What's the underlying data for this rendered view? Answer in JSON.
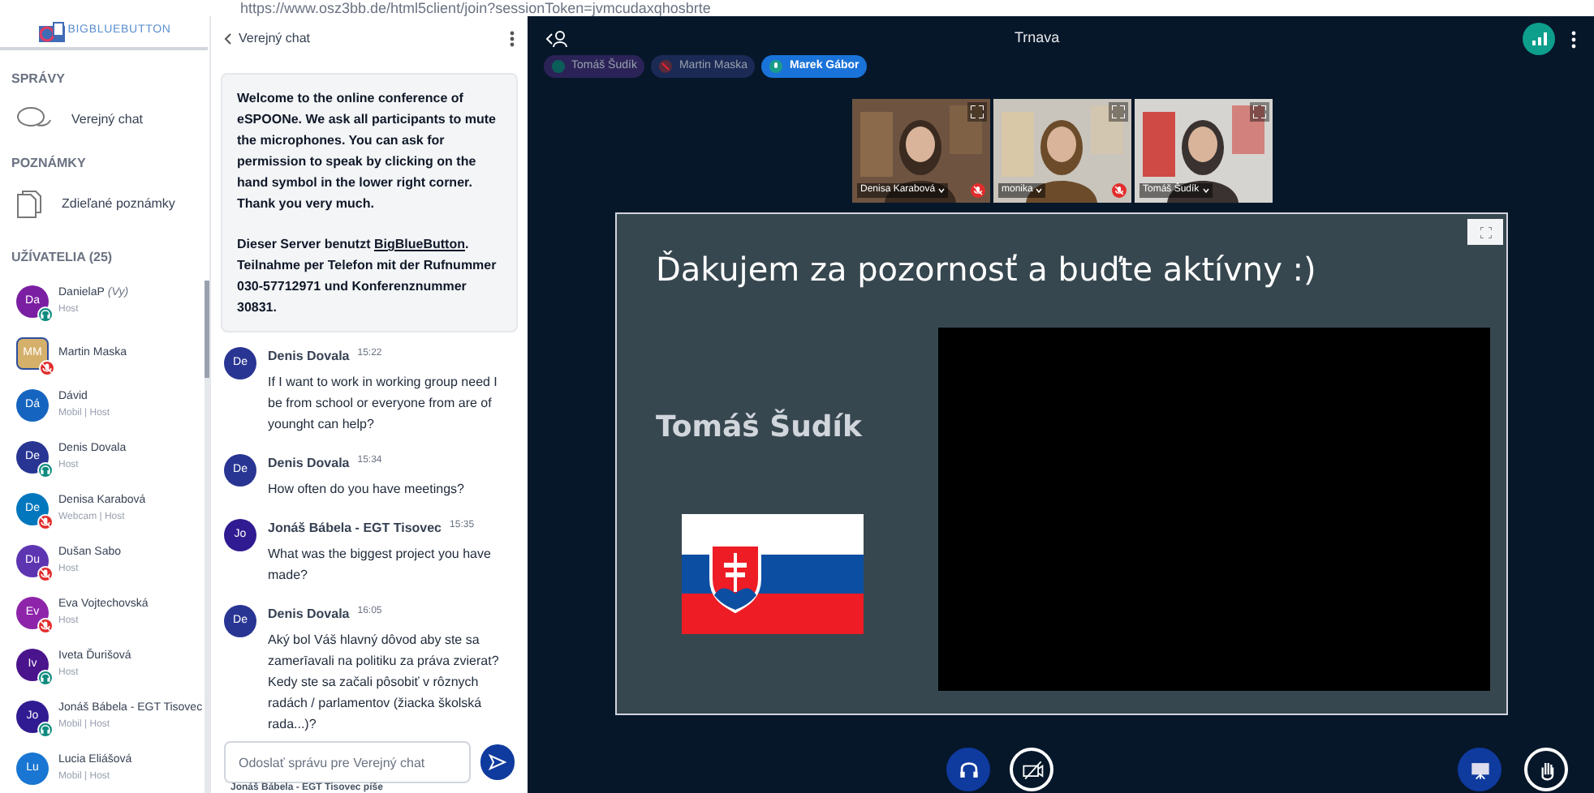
{
  "browser": {
    "url": "https://www.osz3bb.de/html5client/join?sessionToken=jvmcudaxqhosbrte"
  },
  "sidebar": {
    "logo": "BIGBLUEBUTTON",
    "sections": [
      {
        "title": "SPRÁVY",
        "items": [
          {
            "label": "Verejný chat",
            "kind": "chat"
          }
        ]
      },
      {
        "title": "POZNÁMKY",
        "items": [
          {
            "label": "Zdieľané poznámky",
            "kind": "notes"
          }
        ]
      }
    ],
    "users_title": "UŽÍVATELIA (25)",
    "users": [
      {
        "initials": "Da",
        "name": "DanielaP",
        "suffix": "(Vy)",
        "role": "Host",
        "color": "#7b1fa2",
        "listening": true,
        "muted": false,
        "kind": "circle"
      },
      {
        "initials": "MM",
        "name": "Martin Maska",
        "color": "#d4b06a",
        "listening": false,
        "muted": true,
        "kind": "square"
      },
      {
        "initials": "Dá",
        "name": "Dávid",
        "role": "Mobil | Host",
        "color": "#1565c0",
        "listening": false,
        "muted": false,
        "kind": "circle"
      },
      {
        "initials": "De",
        "name": "Denis Dovala",
        "role": "Host",
        "color": "#283593",
        "listening": true,
        "muted": false,
        "kind": "circle"
      },
      {
        "initials": "De",
        "name": "Denisa Karabová",
        "role": "Webcam | Host",
        "color": "#0277bd",
        "listening": false,
        "muted": true,
        "kind": "circle"
      },
      {
        "initials": "Du",
        "name": "Dušan Sabo",
        "role": "Host",
        "color": "#5e35b1",
        "listening": false,
        "muted": true,
        "kind": "circle"
      },
      {
        "initials": "Ev",
        "name": "Eva Vojtechovská",
        "role": "Host",
        "color": "#8e24aa",
        "listening": false,
        "muted": true,
        "kind": "circle"
      },
      {
        "initials": "Iv",
        "name": "Iveta Ďurišová",
        "role": "Host",
        "color": "#4a148c",
        "listening": true,
        "muted": false,
        "kind": "circle"
      },
      {
        "initials": "Jo",
        "name": "Jonáš Bábela - EGT Tisovec",
        "role": "Mobil | Host",
        "color": "#311b92",
        "listening": true,
        "muted": false,
        "kind": "circle"
      },
      {
        "initials": "Lu",
        "name": "Lucia Eliášová",
        "role": "Mobil | Host",
        "color": "#1976d2",
        "listening": false,
        "muted": false,
        "kind": "circle"
      }
    ]
  },
  "chat": {
    "title": "Verejný chat",
    "welcome": "Welcome to the online conference of eSPOONe. We ask all participants to mute the microphones. You can ask for permission to speak by clicking on the hand symbol in the lower right corner. Thank you very much.",
    "server_note": {
      "before": "Dieser Server benutzt ",
      "link": "BigBlueButton",
      "after": ". Teilnahme per Telefon mit der Rufnummer 030-57712971 und Konferenznummer 30831."
    },
    "messages": [
      {
        "initials": "De",
        "author": "Denis Dovala",
        "time": "15:22",
        "text": "If I want to work in working group need I be from school or everyone from are of younght can help?",
        "color": "#283593"
      },
      {
        "initials": "De",
        "author": "Denis Dovala",
        "time": "15:34",
        "text": "How often do you have meetings?",
        "color": "#283593"
      },
      {
        "initials": "Jo",
        "author": "Jonáš Bábela - EGT Tisovec",
        "time": "15:35",
        "text": "What was the biggest project you have made?",
        "color": "#311b92"
      },
      {
        "initials": "De",
        "author": "Denis Dovala",
        "time": "16:05",
        "text": "Aký bol Váš hlavný dôvod aby ste sa zamerīavali na politiku za práva zvierat? Kedy ste sa začali pôsobiť v rôznych radách / parlamentov (žiacka školská rada...)?",
        "color": "#283593"
      }
    ],
    "input": {
      "placeholder": "Odoslať správu pre Verejný chat"
    },
    "typing": "Jonáš Bábela - EGT Tisovec píše"
  },
  "main": {
    "title": "Trnava",
    "talkers": [
      {
        "name": "Tomáš Šudík",
        "kind": "idle"
      },
      {
        "name": "Martin Maska",
        "kind": "muted"
      },
      {
        "name": "Marek Gábor",
        "kind": "talking"
      }
    ],
    "videos": [
      {
        "name": "Denisa Karabová",
        "muted": true,
        "kind": "picture"
      },
      {
        "name": "monika",
        "muted": true,
        "kind": "picture"
      },
      {
        "name": "Tomáš Šudík",
        "muted": false,
        "kind": "picture"
      }
    ],
    "slide": {
      "heading": "Ďakujem za pozornosť a buďte aktívny :)",
      "name": "Tomáš Šudík"
    },
    "controls": [
      {
        "kind": "audio",
        "active": true
      },
      {
        "kind": "camera",
        "active": false
      },
      {
        "kind": "presentation",
        "active": true
      },
      {
        "kind": "hand",
        "active": false
      }
    ]
  }
}
